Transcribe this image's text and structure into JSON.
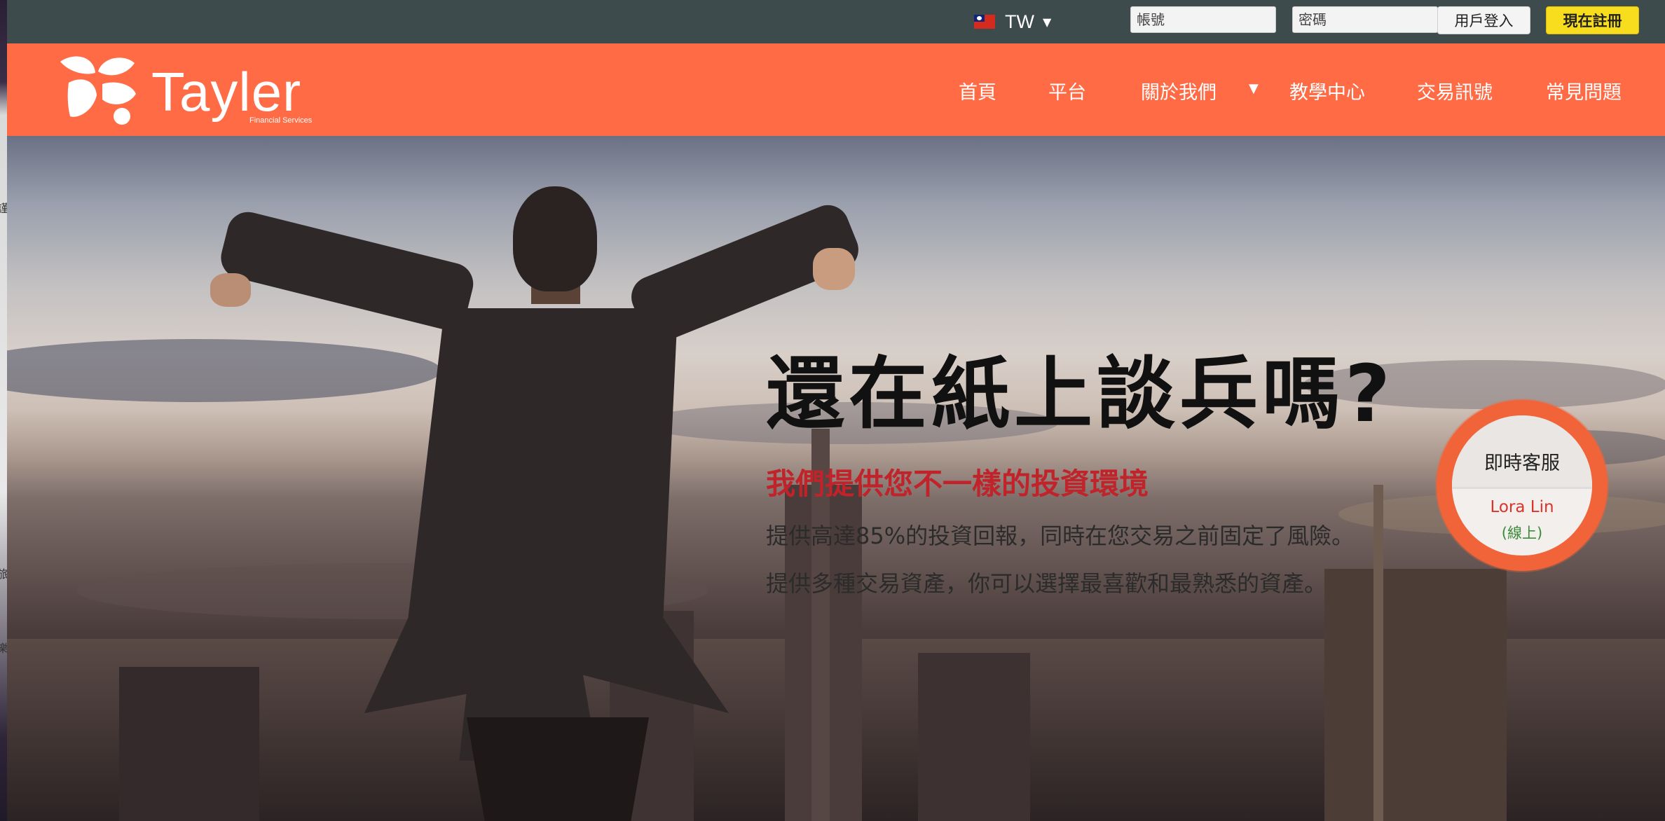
{
  "left_edge": {
    "chars": [
      "謹",
      "旅",
      "樂"
    ]
  },
  "topbar": {
    "language": {
      "code": "TW",
      "flag": "taiwan-flag-icon"
    },
    "account_placeholder": "帳號",
    "password_placeholder": "密碼",
    "login_label": "用戶登入",
    "register_label": "現在註冊"
  },
  "header": {
    "brand": {
      "name": "Tayler",
      "tagline": "Financial Services"
    },
    "nav": [
      {
        "label": "首頁"
      },
      {
        "label": "平台"
      },
      {
        "label": "關於我們",
        "has_dropdown": true
      },
      {
        "label": "教學中心"
      },
      {
        "label": "交易訊號"
      },
      {
        "label": "常見問題"
      }
    ]
  },
  "hero": {
    "title": "還在紙上談兵嗎?",
    "subtitle": "我們提供您不一樣的投資環境",
    "line_1": "提供高達85%的投資回報，同時在您交易之前固定了風險。",
    "line_2": "提供多種交易資產，你可以選擇最喜歡和最熟悉的資產。"
  },
  "chat": {
    "title": "即時客服",
    "agent": "Lora Lin",
    "status": "(線上)"
  },
  "colors": {
    "topbar": "#3e4b4d",
    "header": "#ff6b45",
    "register": "#f7dd1e",
    "subtitle": "#c0232a",
    "chat_ring": "#f1643a",
    "online": "#3a8b3a"
  }
}
